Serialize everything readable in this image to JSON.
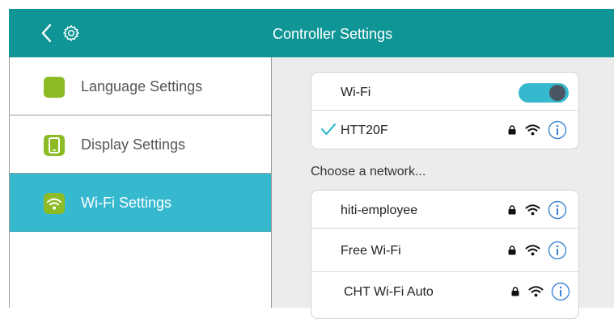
{
  "header": {
    "title": "Controller Settings"
  },
  "sidebar": {
    "items": [
      {
        "label": "Language Settings",
        "icon": "language-icon",
        "color": "#8cbb26"
      },
      {
        "label": "Display Settings",
        "icon": "display-icon",
        "color": "#8cbb26"
      },
      {
        "label": "Wi-Fi Settings",
        "icon": "wifi-icon",
        "color": "#8cbb26",
        "active": true
      }
    ]
  },
  "wifi": {
    "toggle_label": "Wi-Fi",
    "enabled": true,
    "connected_network": "HTT20F"
  },
  "networks": {
    "section_label": "Choose a network...",
    "items": [
      {
        "name": "hiti-employee",
        "secured": true
      },
      {
        "name": "Free Wi-Fi",
        "secured": true
      },
      {
        "name": "CHT Wi-Fi Auto",
        "secured": true
      }
    ]
  },
  "colors": {
    "header": "#0f9596",
    "accent": "#36b8cf",
    "icon_green": "#8cbb26",
    "knob": "#4a5662",
    "info_blue": "#3a86d4"
  }
}
